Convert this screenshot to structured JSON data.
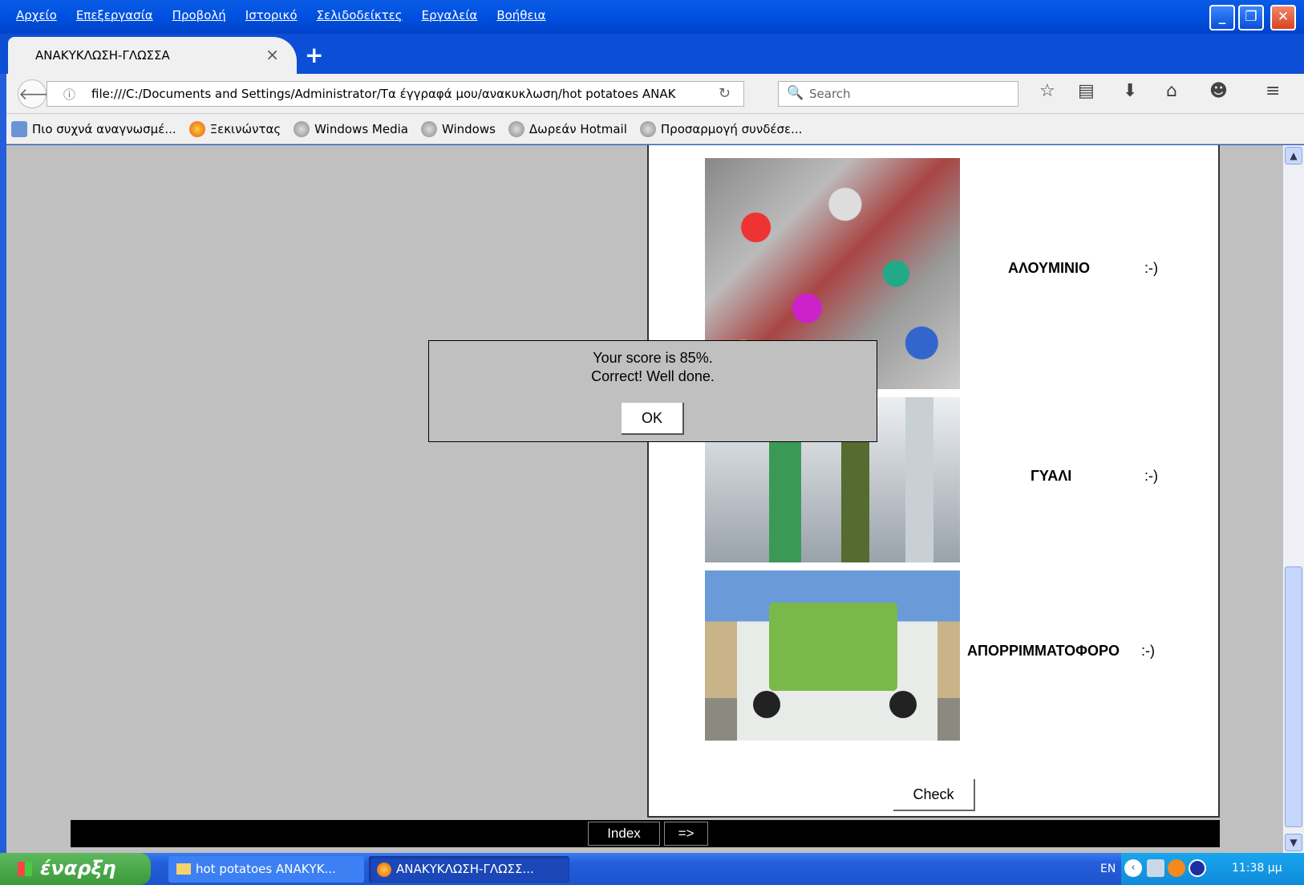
{
  "menu": [
    "Αρχείο",
    "Επεξεργασία",
    "Προβολή",
    "Ιστορικό",
    "Σελιδοδείκτες",
    "Εργαλεία",
    "Βοήθεια"
  ],
  "tab": {
    "title": "ΑΝΑΚΥΚΛΩΣΗ-ΓΛΩΣΣΑ",
    "close": "×",
    "new": "+"
  },
  "nav": {
    "url": "file:///C:/Documents and Settings/Administrator/Τα έγγραφά μου/ανακυκλωση/hot potatoes ΑΝΑΚ",
    "search_placeholder": "Search"
  },
  "bookmarks": [
    "Πιο συχνά αναγνωσμέ...",
    "Ξεκινώντας",
    "Windows Media",
    "Windows",
    "Δωρεάν Hotmail",
    "Προσαρμογή συνδέσε..."
  ],
  "quiz": {
    "rows": [
      {
        "label": "ΑΛΟΥΜΙΝΙΟ",
        "feedback": ":-)"
      },
      {
        "label": "ΓΥΑΛΙ",
        "feedback": ":-)"
      },
      {
        "label": "ΑΠΟΡΡΙΜΜΑΤΟΦΟΡΟ",
        "feedback": ":-)"
      }
    ],
    "check_label": "Check",
    "index_label": "Index",
    "next_label": "=>"
  },
  "dialog": {
    "line1": "Your score is 85%.",
    "line2": "Correct! Well done.",
    "ok": "OK"
  },
  "taskbar": {
    "start": "έναρξη",
    "tasks": [
      "hot potatoes ΑΝΑΚΥΚ...",
      "ΑΝΑΚΥΚΛΩΣΗ-ΓΛΩΣΣ..."
    ],
    "lang": "EN",
    "clock": "11:38 μμ"
  }
}
